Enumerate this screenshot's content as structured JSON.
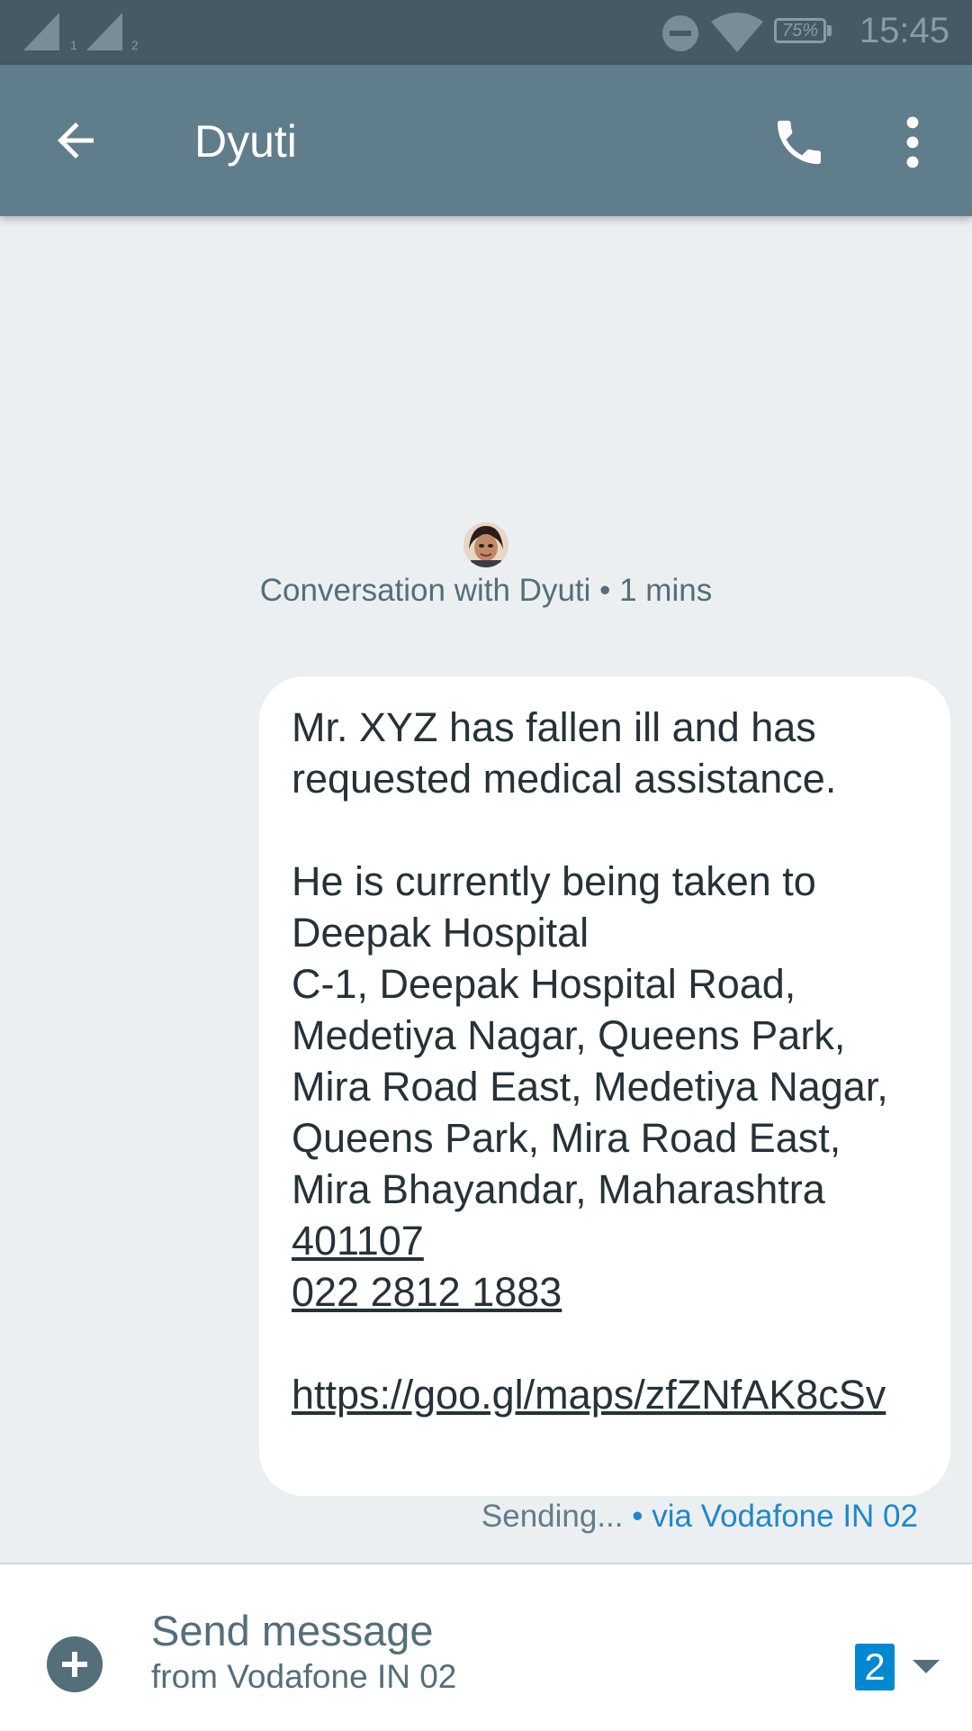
{
  "status_bar": {
    "sim1": "1",
    "sim2": "2",
    "battery": "75%",
    "time": "15:45",
    "icons": [
      "signal-icon",
      "signal-icon",
      "dnd-icon",
      "wifi-icon",
      "battery-icon"
    ]
  },
  "app_bar": {
    "title": "Dyuti",
    "icons": [
      "back-arrow-icon",
      "phone-icon",
      "more-vert-icon"
    ]
  },
  "conversation": {
    "header": "Conversation with Dyuti • 1 mins"
  },
  "message": {
    "body": "Mr. XYZ has fallen ill and has requested medical assistance.\n\nHe is currently being taken to Deepak Hospital\nC-1, Deepak Hospital Road, Medetiya Nagar, Queens Park, Mira Road East, Medetiya Nagar, Queens Park, Mira Road East, Mira Bhayandar, Maharashtra",
    "pincode": "401107",
    "phone": "022 2812 1883",
    "url": "https://goo.gl/maps/zfZNfAK8cSv",
    "status": "Sending...",
    "via": " • via Vodafone IN 02"
  },
  "compose": {
    "placeholder": "Send message",
    "from": "from Vodafone IN 02",
    "sim_badge": "2"
  },
  "colors": {
    "status_bar": "#455A64",
    "app_bar": "#607D8B",
    "background": "#ECEFF1",
    "accent": "#0288D1"
  }
}
